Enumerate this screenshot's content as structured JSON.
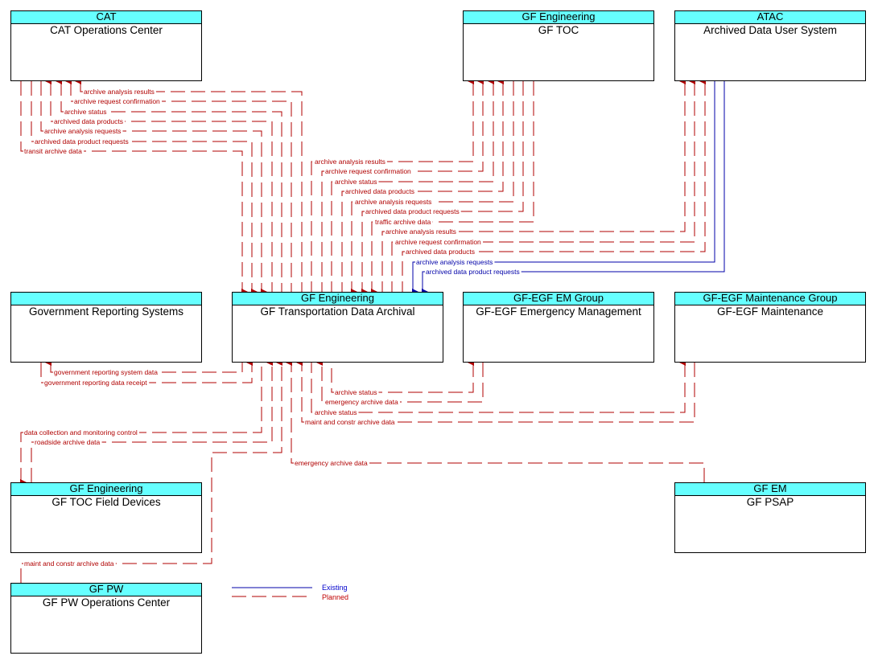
{
  "colors": {
    "planned": "#b00000",
    "existing": "#0000a8",
    "header": "#66ffff"
  },
  "boxes": {
    "cat": {
      "org": "CAT",
      "name": "CAT Operations Center"
    },
    "gftoc": {
      "org": "GF Engineering",
      "name": "GF TOC"
    },
    "atac": {
      "org": "ATAC",
      "name": "Archived Data User System"
    },
    "gov": {
      "org": "",
      "name": "Government Reporting Systems"
    },
    "archival": {
      "org": "GF Engineering",
      "name": "GF Transportation Data Archival"
    },
    "egfem": {
      "org": "GF-EGF EM Group",
      "name": "GF-EGF Emergency Management"
    },
    "egfmaint": {
      "org": "GF-EGF Maintenance Group",
      "name": "GF-EGF Maintenance"
    },
    "tocfield": {
      "org": "GF Engineering",
      "name": "GF TOC Field Devices"
    },
    "psap": {
      "org": "GF EM",
      "name": "GF PSAP"
    },
    "pw": {
      "org": "GF PW",
      "name": "GF PW Operations Center"
    }
  },
  "flows": {
    "cat": [
      {
        "label": "archive analysis results",
        "status": "planned",
        "direction": "to CAT Operations Center"
      },
      {
        "label": "archive request confirmation",
        "status": "planned",
        "direction": "to CAT Operations Center"
      },
      {
        "label": "archive status",
        "status": "planned",
        "direction": "to CAT Operations Center"
      },
      {
        "label": "archived data products",
        "status": "planned",
        "direction": "to CAT Operations Center"
      },
      {
        "label": "archive analysis requests",
        "status": "planned",
        "direction": "to GF Transportation Data Archival"
      },
      {
        "label": "archived data product requests",
        "status": "planned",
        "direction": "to GF Transportation Data Archival"
      },
      {
        "label": "transit archive data",
        "status": "planned",
        "direction": "to GF Transportation Data Archival"
      }
    ],
    "gftoc": [
      {
        "label": "archive analysis results",
        "status": "planned",
        "direction": "to GF TOC"
      },
      {
        "label": "archive request confirmation",
        "status": "planned",
        "direction": "to GF TOC"
      },
      {
        "label": "archive status",
        "status": "planned",
        "direction": "to GF TOC"
      },
      {
        "label": "archived data products",
        "status": "planned",
        "direction": "to GF TOC"
      },
      {
        "label": "archive analysis requests",
        "status": "planned",
        "direction": "to GF Transportation Data Archival"
      },
      {
        "label": "archived data product requests",
        "status": "planned",
        "direction": "to GF Transportation Data Archival"
      },
      {
        "label": "traffic archive data",
        "status": "planned",
        "direction": "to GF Transportation Data Archival"
      }
    ],
    "atac": [
      {
        "label": "archive analysis results",
        "status": "planned",
        "direction": "to Archived Data User System"
      },
      {
        "label": "archive request confirmation",
        "status": "planned",
        "direction": "to Archived Data User System"
      },
      {
        "label": "archived data products",
        "status": "planned",
        "direction": "to Archived Data User System"
      },
      {
        "label": "archive analysis requests",
        "status": "existing",
        "direction": "to GF Transportation Data Archival"
      },
      {
        "label": "archived data product requests",
        "status": "existing",
        "direction": "to GF Transportation Data Archival"
      }
    ],
    "gov": [
      {
        "label": "government reporting system data",
        "status": "planned",
        "direction": "to Government Reporting Systems"
      },
      {
        "label": "government reporting data receipt",
        "status": "planned",
        "direction": "to GF Transportation Data Archival"
      }
    ],
    "egfem": [
      {
        "label": "archive status",
        "status": "planned",
        "direction": "to GF-EGF Emergency Management"
      },
      {
        "label": "emergency archive data",
        "status": "planned",
        "direction": "to GF Transportation Data Archival"
      }
    ],
    "egfmaint": [
      {
        "label": "archive status",
        "status": "planned",
        "direction": "to GF-EGF Maintenance"
      },
      {
        "label": "maint and constr archive data",
        "status": "planned",
        "direction": "to GF Transportation Data Archival"
      }
    ],
    "tocfield": [
      {
        "label": "data collection and monitoring control",
        "status": "planned",
        "direction": "to GF TOC Field Devices"
      },
      {
        "label": "roadside archive data",
        "status": "planned",
        "direction": "to GF Transportation Data Archival"
      }
    ],
    "psap": [
      {
        "label": "emergency archive data",
        "status": "planned",
        "direction": "to GF Transportation Data Archival"
      }
    ],
    "pw": [
      {
        "label": "maint and constr archive data",
        "status": "planned",
        "direction": "to GF Transportation Data Archival"
      }
    ]
  },
  "legend": {
    "existing": "Existing",
    "planned": "Planned"
  }
}
